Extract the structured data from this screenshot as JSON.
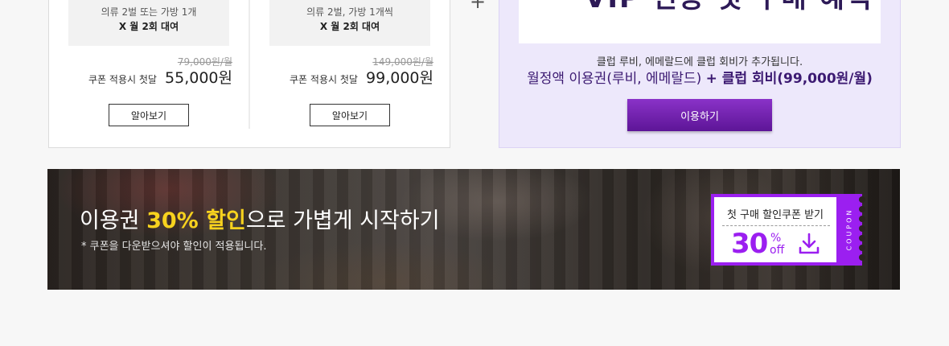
{
  "plans": [
    {
      "description": "의류 2벌 또는 가방 1개",
      "frequency": "X 월 2회 대여",
      "original_price": "79,000원/월",
      "coupon_label": "쿠폰 적용시 첫달",
      "coupon_price": "55,000원",
      "more_button": "알아보기"
    },
    {
      "description": "의류 2벌, 가방 1개씩",
      "frequency": "X 월 2회 대여",
      "original_price": "149,000원/월",
      "coupon_label": "쿠폰 적용시 첫달",
      "coupon_price": "99,000원",
      "more_button": "알아보기"
    }
  ],
  "plus_sign": "+",
  "vip": {
    "header_text": "VIP 전용 첫 구매 혜택",
    "line1": "클럽 루비, 에메랄드에 클럽 회비가 추가됩니다.",
    "line2_normal": "월정액 이용권(루비, 에메랄드) ",
    "line2_bold": "+ 클럽 회비(99,000원/월)",
    "use_button": "이용하기"
  },
  "banner": {
    "title_before": "이용권 ",
    "title_highlight": "30% 할인",
    "title_after": "으로 가볍게 시작하기",
    "note": "* 쿠폰을 다운받으셔야 할인이 적용됩니다.",
    "coupon": {
      "title": "첫 구매 할인쿠폰 받기",
      "number": "30",
      "percent": "%",
      "off": "off",
      "stub_text": "COUPON"
    }
  },
  "colors": {
    "accent_purple": "#9b1ff0",
    "vip_background": "#ede8fb",
    "vip_text": "#3c1a72",
    "highlight_yellow": "#f7d21e"
  },
  "icons": {
    "download": "download-icon"
  }
}
